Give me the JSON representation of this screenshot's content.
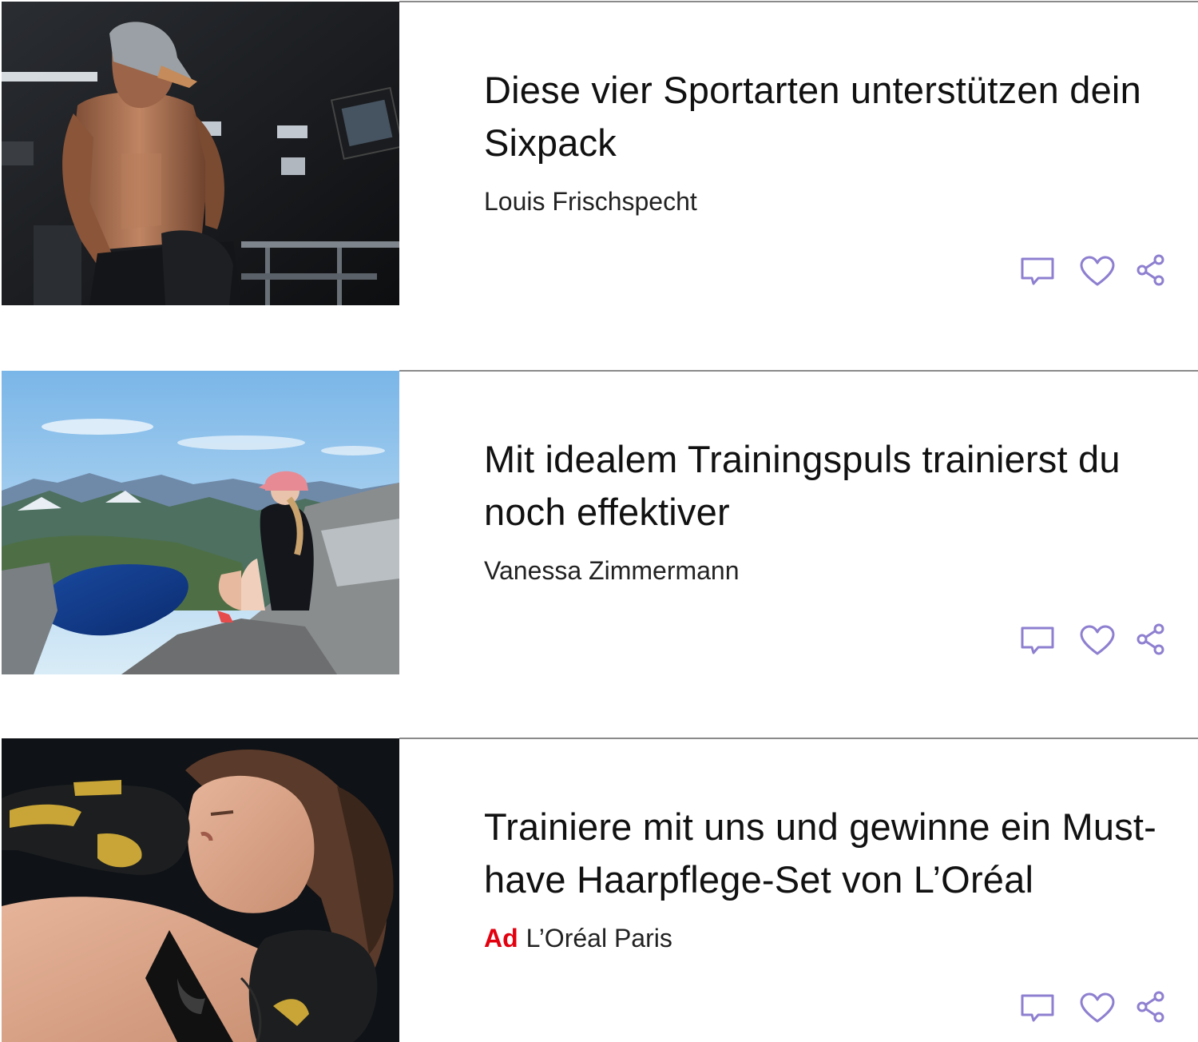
{
  "articles": [
    {
      "title": "Diese vier Sportarten unterstützen dein Sixpack",
      "author": "Louis Frischspecht",
      "ad_label": "",
      "image": "shirtless man with cap in gym"
    },
    {
      "title": "Mit idealem Trainingspuls trainierst du noch effektiver",
      "author": "Vanessa Zimmermann",
      "ad_label": "",
      "image": "woman with pink cap sitting on mountain above fjord"
    },
    {
      "title": "Trainiere mit uns und gewinne ein Must-have Haarpflege-Set von L’Oréal",
      "author": "L’Oréal Paris",
      "ad_label": "Ad",
      "image": "woman kissing boxing glove"
    }
  ],
  "icons": {
    "comment": "comment-icon",
    "like": "heart-icon",
    "share": "share-icon"
  },
  "colors": {
    "icon_accent": "#8e7fd0",
    "ad_label": "#e3000f",
    "divider": "#8a8a8a"
  }
}
